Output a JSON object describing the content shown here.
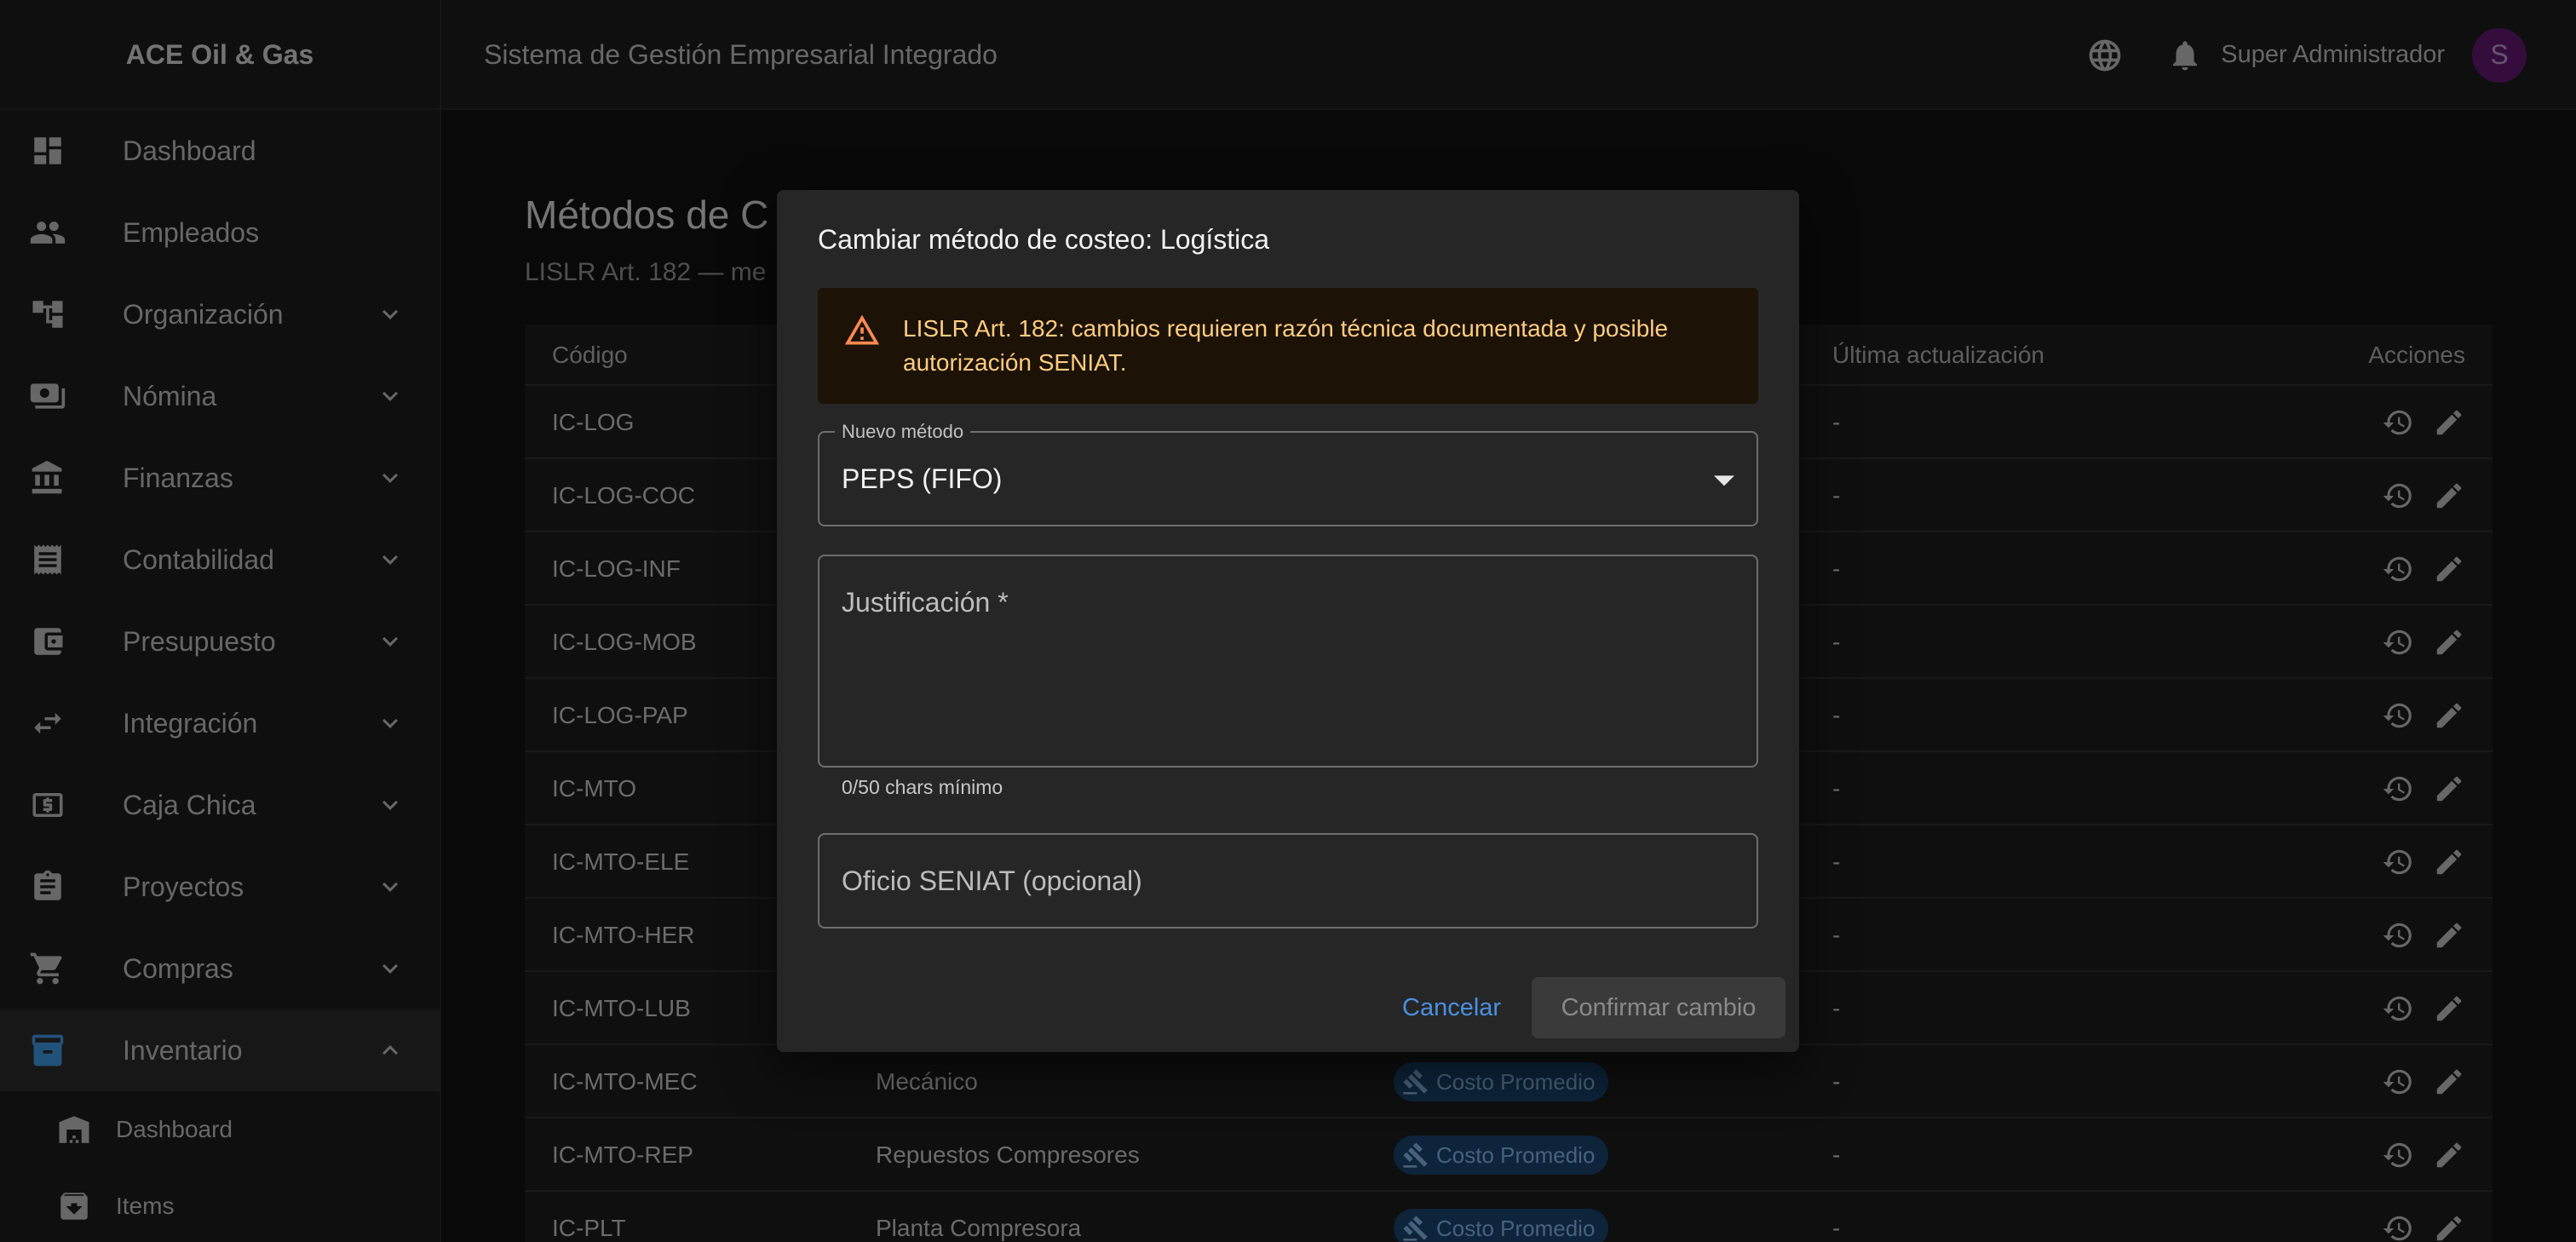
{
  "appbar": {
    "brand": "ACE Oil & Gas",
    "title": "Sistema de Gestión Empresarial Integrado",
    "user_name": "Super Administrador",
    "avatar_initial": "S"
  },
  "sidebar": {
    "items": [
      {
        "label": "Dashboard",
        "icon": "dashboard-icon"
      },
      {
        "label": "Empleados",
        "icon": "people-icon"
      },
      {
        "label": "Organización",
        "icon": "org-chart-icon"
      },
      {
        "label": "Nómina",
        "icon": "payroll-icon"
      },
      {
        "label": "Finanzas",
        "icon": "bank-icon"
      },
      {
        "label": "Contabilidad",
        "icon": "receipt-icon"
      },
      {
        "label": "Presupuesto",
        "icon": "wallet-icon"
      },
      {
        "label": "Integración",
        "icon": "swap-icon"
      },
      {
        "label": "Caja Chica",
        "icon": "cash-icon"
      },
      {
        "label": "Proyectos",
        "icon": "clipboard-icon"
      },
      {
        "label": "Compras",
        "icon": "cart-icon"
      },
      {
        "label": "Inventario",
        "icon": "archive-icon"
      }
    ],
    "sub_items": [
      {
        "label": "Dashboard",
        "icon": "warehouse-icon"
      },
      {
        "label": "Items",
        "icon": "inventory-icon"
      }
    ]
  },
  "page": {
    "title": "Métodos de C",
    "subtitle": "LISLR Art. 182 — me"
  },
  "table": {
    "headers": {
      "codigo": "Código",
      "ultima": "Última actualización",
      "acciones": "Acciones"
    },
    "rows": [
      {
        "codigo": "IC-LOG",
        "nombre": "",
        "metodo": "",
        "ultima": "-"
      },
      {
        "codigo": "IC-LOG-COC",
        "nombre": "",
        "metodo": "",
        "ultima": "-"
      },
      {
        "codigo": "IC-LOG-INF",
        "nombre": "",
        "metodo": "",
        "ultima": "-"
      },
      {
        "codigo": "IC-LOG-MOB",
        "nombre": "",
        "metodo": "",
        "ultima": "-"
      },
      {
        "codigo": "IC-LOG-PAP",
        "nombre": "",
        "metodo": "",
        "ultima": "-"
      },
      {
        "codigo": "IC-MTO",
        "nombre": "",
        "metodo": "",
        "ultima": "-"
      },
      {
        "codigo": "IC-MTO-ELE",
        "nombre": "",
        "metodo": "",
        "ultima": "-"
      },
      {
        "codigo": "IC-MTO-HER",
        "nombre": "",
        "metodo": "",
        "ultima": "-"
      },
      {
        "codigo": "IC-MTO-LUB",
        "nombre": "",
        "metodo": "",
        "ultima": "-"
      },
      {
        "codigo": "IC-MTO-MEC",
        "nombre": "Mecánico",
        "metodo": "Costo Promedio",
        "ultima": "-"
      },
      {
        "codigo": "IC-MTO-REP",
        "nombre": "Repuestos Compresores",
        "metodo": "Costo Promedio",
        "ultima": "-"
      },
      {
        "codigo": "IC-PLT",
        "nombre": "Planta Compresora",
        "metodo": "Costo Promedio",
        "ultima": "-"
      }
    ]
  },
  "dialog": {
    "title": "Cambiar método de costeo: Logística",
    "alert": "LISLR Art. 182: cambios requieren razón técnica documentada y posible autorización SENIAT.",
    "method_label": "Nuevo método",
    "method_value": "PEPS (FIFO)",
    "justification_placeholder": "Justificación *",
    "justification_value": "",
    "helper": "0/50 chars mínimo",
    "oficio_placeholder": "Oficio SENIAT (opcional)",
    "oficio_value": "",
    "cancel_label": "Cancelar",
    "confirm_label": "Confirmar cambio"
  },
  "colors": {
    "accent": "#4a90e2",
    "warning": "#ff8a50",
    "chip_bg": "#1a4876",
    "chip_text": "#90c2f5",
    "avatar": "#6a1b7a"
  }
}
